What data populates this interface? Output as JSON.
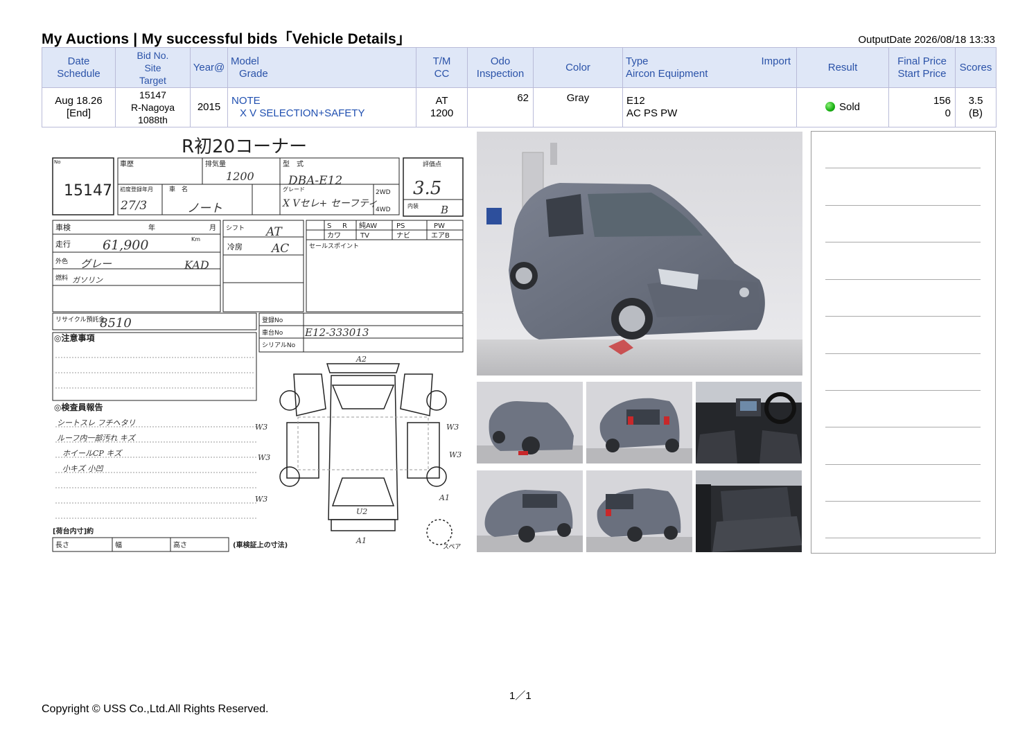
{
  "page": {
    "title": "My Auctions | My successful bids「Vehicle Details」",
    "output_date": "OutputDate  2026/08/18 13:33"
  },
  "table": {
    "headers": {
      "date": "Date",
      "schedule": "Schedule",
      "bid_no": "Bid No.",
      "site": "Site",
      "target": "Target",
      "year": "Year@",
      "model": "Model",
      "grade": "Grade",
      "tm": "T/M",
      "cc": "CC",
      "odo": "Odo",
      "inspection": "Inspection",
      "color": "Color",
      "type": "Type",
      "import": "Import",
      "aircon": "Aircon Equipment",
      "result": "Result",
      "final_price": "Final Price",
      "start_price": "Start Price",
      "scores": "Scores"
    },
    "row": {
      "date": "Aug 18.26",
      "schedule": "[End]",
      "bid_no": "15147",
      "site": "R-Nagoya",
      "target": "1088th",
      "year": "2015",
      "model": "NOTE",
      "grade": "X V SELECTION+SAFETY",
      "tm": "AT",
      "cc": "1200",
      "odo": "62",
      "inspection": "",
      "color": "Gray",
      "type": "E12",
      "aircon": "AC PS PW",
      "result": "Sold",
      "result_color": "#18b012",
      "final_price": "156",
      "start_price": "0",
      "score": "3.5",
      "score_sub": "(B)"
    }
  },
  "auction_sheet": {
    "header": "R初20コーナー",
    "lot_no": "15147",
    "displacement": "1200",
    "model_code": "DBA-E12",
    "reg_date": "27/3",
    "car_name": "ノート",
    "grade_text": "X Vセレ+ セーフティ",
    "score": "3.5",
    "interior": "B",
    "shift": "AT",
    "aircon": "AC",
    "mileage": "61,900",
    "color_text": "グレー",
    "color_code": "KAD",
    "fuel": "ガソリン",
    "recycle_fee": "8510",
    "chassis_no": "E12-333013",
    "labels": {
      "no": "No",
      "history": "車歴",
      "disp_label": "排気量",
      "type_label": "型　式",
      "score_label": "評価点",
      "first_reg": "初度登録年月",
      "car_name_label": "車　名",
      "grade_label": "グレード",
      "wd2": "2WD",
      "wd4": "4WD",
      "interior_label": "内装",
      "shaken": "車検",
      "year_label": "年",
      "month_label": "月",
      "shift_label": "シフト",
      "mileage_label": "走行",
      "km": "Km",
      "cool_label": "冷房",
      "color_label": "外色",
      "fuel_label": "燃料",
      "sales_point": "セールスポイント",
      "recycle": "リサイクル預託金",
      "registration": "登録No",
      "chassis_label": "車台No",
      "serial_label": "シリアルNo",
      "caution": "◎注意事項",
      "inspector": "◎検査員報告",
      "loading": "[荷台内寸]約",
      "length": "長さ",
      "width": "幅",
      "height": "高さ",
      "dims_note": "(車検証上の寸法)",
      "spare": "スペア",
      "opts": [
        "S",
        "R",
        "純AW",
        "PS",
        "PW",
        "カワ",
        "TV",
        "ナビ",
        "エアB"
      ]
    },
    "handwritten_notes": [
      "シートスレ フチヘタリ",
      "ルーフ内一部汚れ キズ",
      "ホイールCP キズ",
      "小キズ 小凹"
    ],
    "damage_marks": [
      "A2",
      "W3",
      "W3",
      "W3",
      "W3",
      "W3",
      "U2",
      "A1",
      "A1"
    ]
  },
  "photos": {
    "main_color": "#6f7684",
    "thumb_count": 6
  },
  "footer": {
    "page_num": "1／1",
    "copyright": "Copyright © USS Co.,Ltd.All Rights Reserved."
  }
}
